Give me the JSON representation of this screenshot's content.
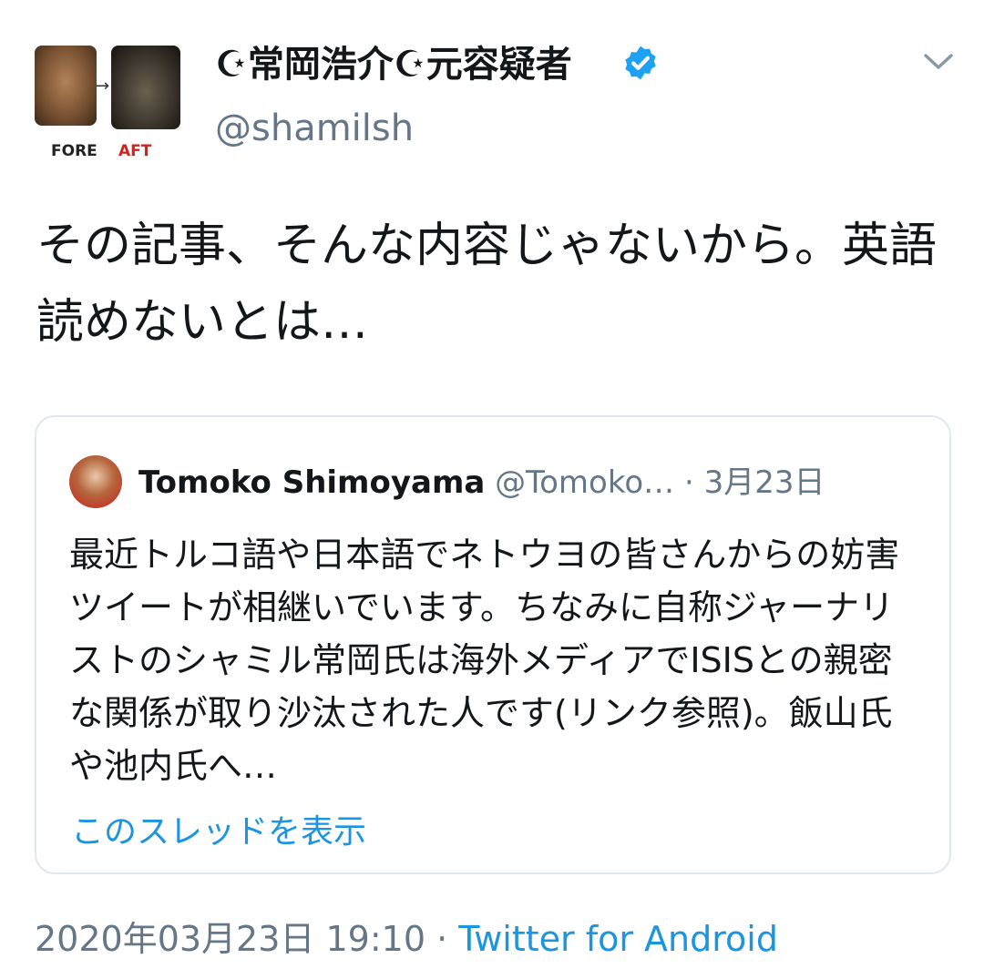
{
  "author": {
    "display_name": "☪常岡浩介☪元容疑者",
    "handle": "@shamilsh",
    "avatar_before_label": "FORE",
    "avatar_after_label": "AFT"
  },
  "tweet": {
    "text": "その記事、そんな内容じゃないから。英語読めないとは…"
  },
  "quote": {
    "author_name": "Tomoko Shimoyama",
    "author_handle": "@Tomoko…",
    "separator": " · ",
    "date": "3月23日",
    "text": "最近トルコ語や日本語でネトウヨの皆さんからの妨害ツイートが相継いでいます。ちなみに自称ジャーナリストのシャミル常岡氏は海外メディアでISISとの親密な関係が取り沙汰された人です(リンク参照)。飯山氏や池内氏へ…",
    "show_thread": "このスレッドを表示"
  },
  "meta": {
    "timestamp": "2020年03月23日 19:10",
    "separator": " · ",
    "source": "Twitter for Android"
  },
  "colors": {
    "text": "#14171a",
    "secondary": "#657786",
    "link": "#1b95e0",
    "verified": "#1da1f2",
    "border": "#e1e8ed"
  },
  "icons": [
    "verified-badge-icon",
    "chevron-down-icon"
  ]
}
